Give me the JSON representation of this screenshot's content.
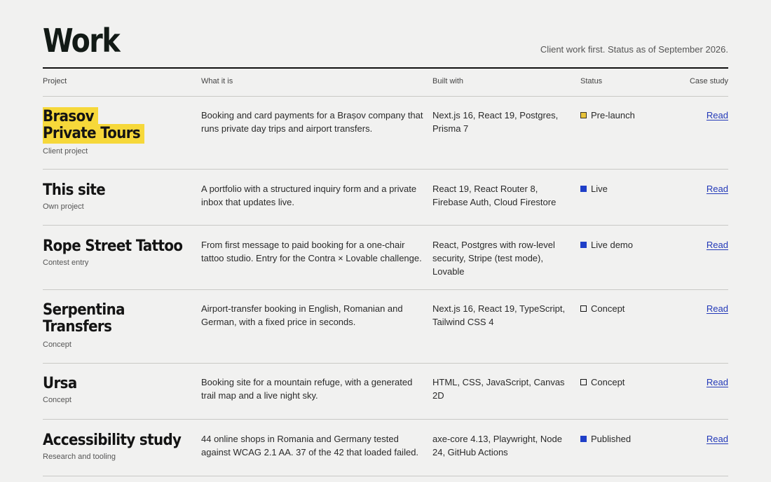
{
  "header": {
    "title": "Work",
    "subtitle": "Client work first. Status as of September 2026."
  },
  "columns": {
    "project": "Project",
    "what": "What it is",
    "built": "Built with",
    "status": "Status",
    "case": "Case study"
  },
  "rows": [
    {
      "name_lines": [
        "Brasov",
        "Private Tours"
      ],
      "type": "Client project",
      "what": "Booking and card payments for a Brașov company that runs private day trips and airport transfers.",
      "built": "Next.js 16, React 19, Postgres, Prisma 7",
      "status": "Pre-launch",
      "status_style": "yellow",
      "link": "Read"
    },
    {
      "name_lines": [
        "This site"
      ],
      "type": "Own project",
      "what": "A portfolio with a structured inquiry form and a private inbox that updates live.",
      "built": "React 19, React Router 8, Firebase Auth, Cloud Firestore",
      "status": "Live",
      "status_style": "blue",
      "link": "Read"
    },
    {
      "name_lines": [
        "Rope Street Tattoo"
      ],
      "type": "Contest entry",
      "what": "From first message to paid booking for a one-chair tattoo studio. Entry for the Contra × Lovable challenge.",
      "built": "React, Postgres with row-level security, Stripe (test mode), Lovable",
      "status": "Live demo",
      "status_style": "blue",
      "link": "Read"
    },
    {
      "name_lines": [
        "Serpentina",
        "Transfers"
      ],
      "type": "Concept",
      "what": "Airport-transfer booking in English, Romanian and German, with a fixed price in seconds.",
      "built": "Next.js 16, React 19, TypeScript, Tailwind CSS 4",
      "status": "Concept",
      "status_style": "empty",
      "link": "Read"
    },
    {
      "name_lines": [
        "Ursa"
      ],
      "type": "Concept",
      "what": "Booking site for a mountain refuge, with a generated trail map and a live night sky.",
      "built": "HTML, CSS, JavaScript, Canvas 2D",
      "status": "Concept",
      "status_style": "empty",
      "link": "Read"
    },
    {
      "name_lines": [
        "Accessibility study"
      ],
      "type": "Research and tooling",
      "what": "44 online shops in Romania and Germany tested against WCAG 2.1 AA. 37 of the 42 that loaded failed.",
      "built": "axe-core 4.13, Playwright, Node 24, GitHub Actions",
      "status": "Published",
      "status_style": "blue",
      "link": "Read"
    }
  ],
  "colors": {
    "highlight": "#f6d83a",
    "link": "#2238b8",
    "status_blue": "#1f3fc8",
    "status_yellow": "#e8c33a"
  }
}
